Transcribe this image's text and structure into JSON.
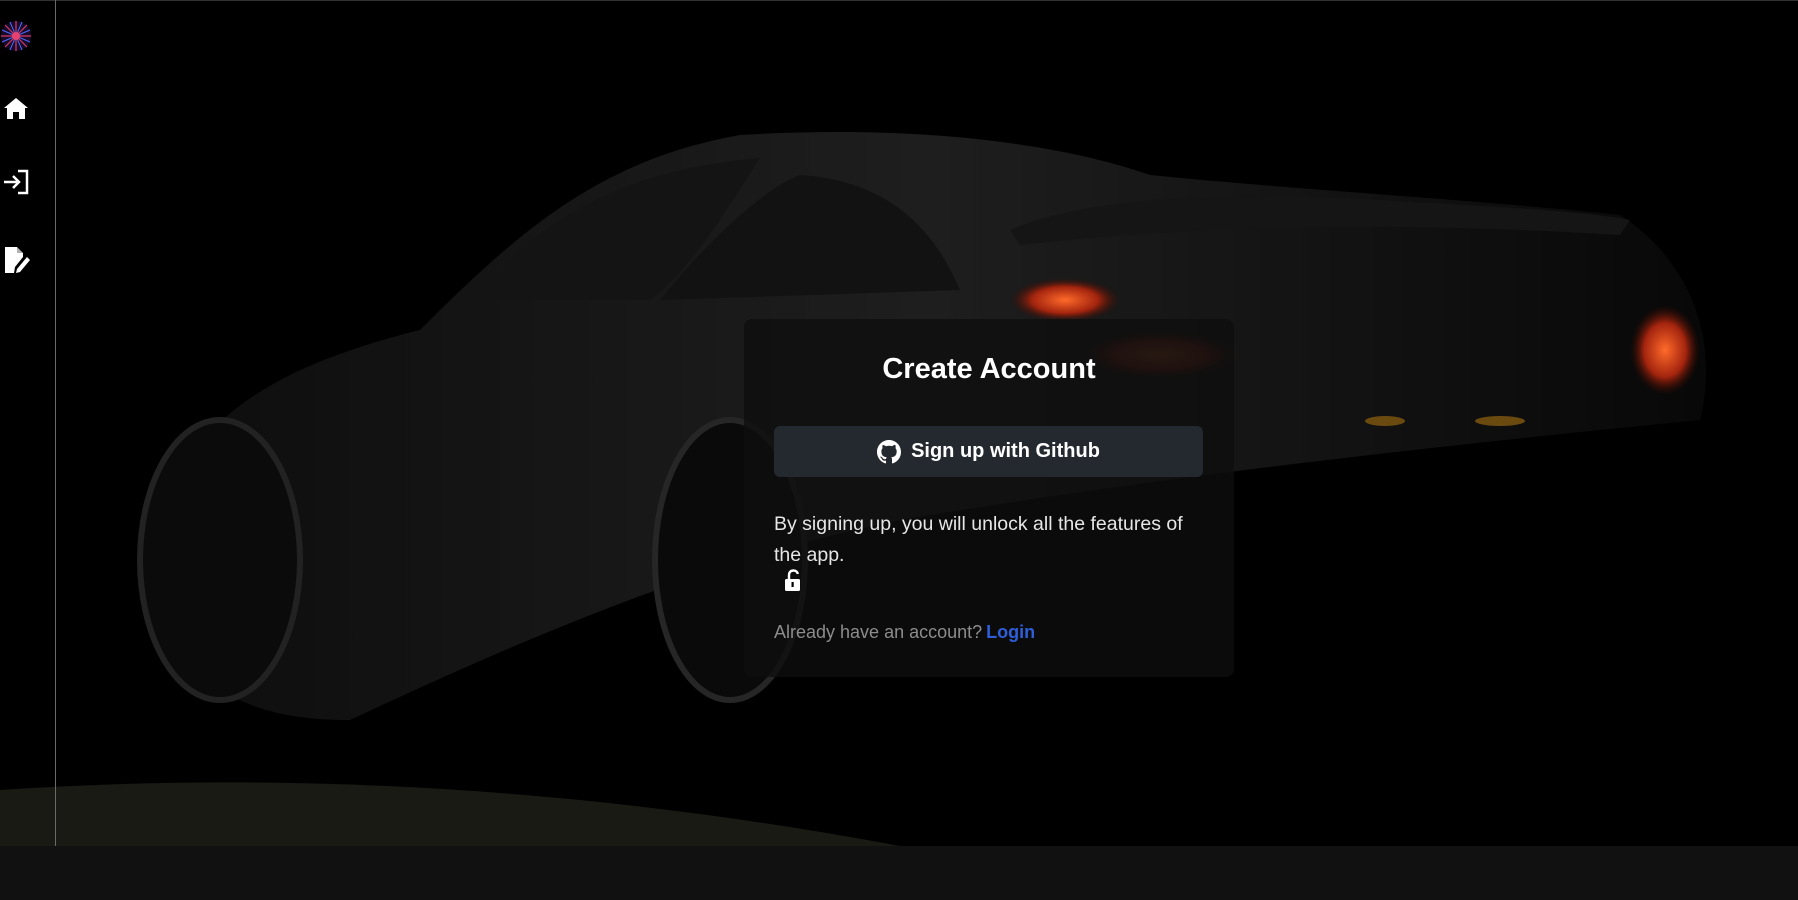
{
  "nav": {
    "items": [
      {
        "icon": "logo-icon"
      },
      {
        "icon": "home-icon"
      },
      {
        "icon": "login-icon"
      },
      {
        "icon": "signup-icon"
      }
    ]
  },
  "card": {
    "title": "Create Account",
    "github_button_label": "Sign up with Github",
    "info_text": "By signing up, you will unlock all the features of the app.",
    "login_prompt": "Already have an account?",
    "login_link": "Login"
  },
  "colors": {
    "accent": "#2f5fd8",
    "button_bg": "#24292f",
    "page_bg": "#000000"
  }
}
